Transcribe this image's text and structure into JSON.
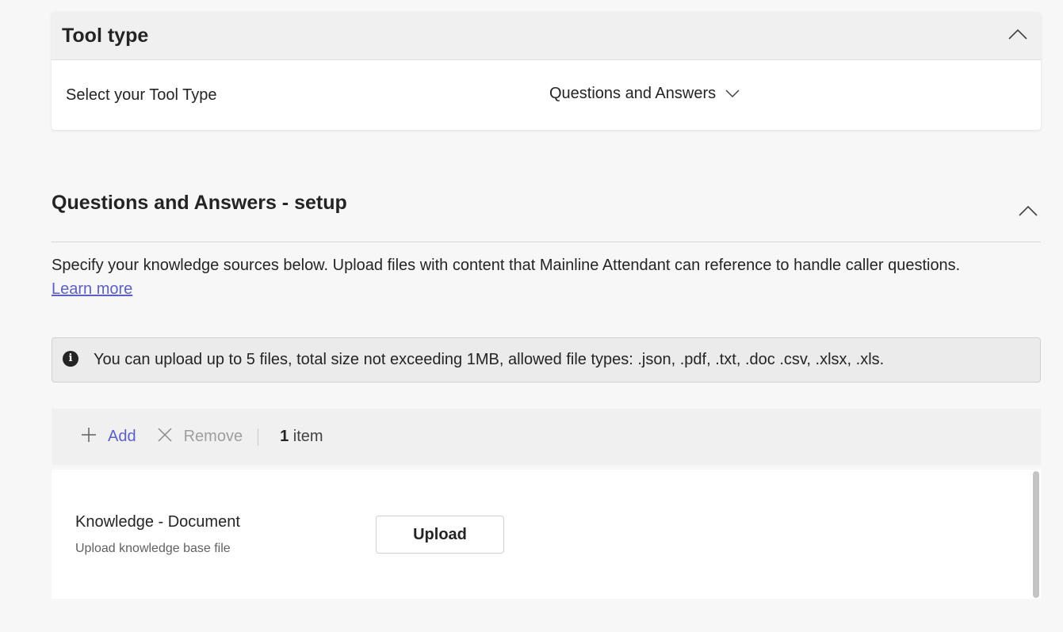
{
  "tool_type": {
    "title": "Tool type",
    "select_label": "Select your Tool Type",
    "selected_value": "Questions and Answers"
  },
  "qna": {
    "title": "Questions and Answers - setup",
    "description": "Specify your knowledge sources below. Upload files with content that Mainline Attendant can reference to handle caller questions.",
    "learn_more": "Learn more",
    "info_message": "You can upload up to 5 files, total size not exceeding 1MB, allowed file types: .json, .pdf, .txt, .doc .csv, .xlsx, .xls.",
    "toolbar": {
      "add_label": "Add",
      "remove_label": "Remove",
      "count_number": "1",
      "count_suffix": "item"
    },
    "items": [
      {
        "title": "Knowledge - Document",
        "subtitle": "Upload knowledge base file",
        "button_label": "Upload"
      }
    ]
  },
  "colors": {
    "accent": "#5b5fc7",
    "background": "#f7f7f7",
    "header_bg": "#f0f0f0"
  }
}
